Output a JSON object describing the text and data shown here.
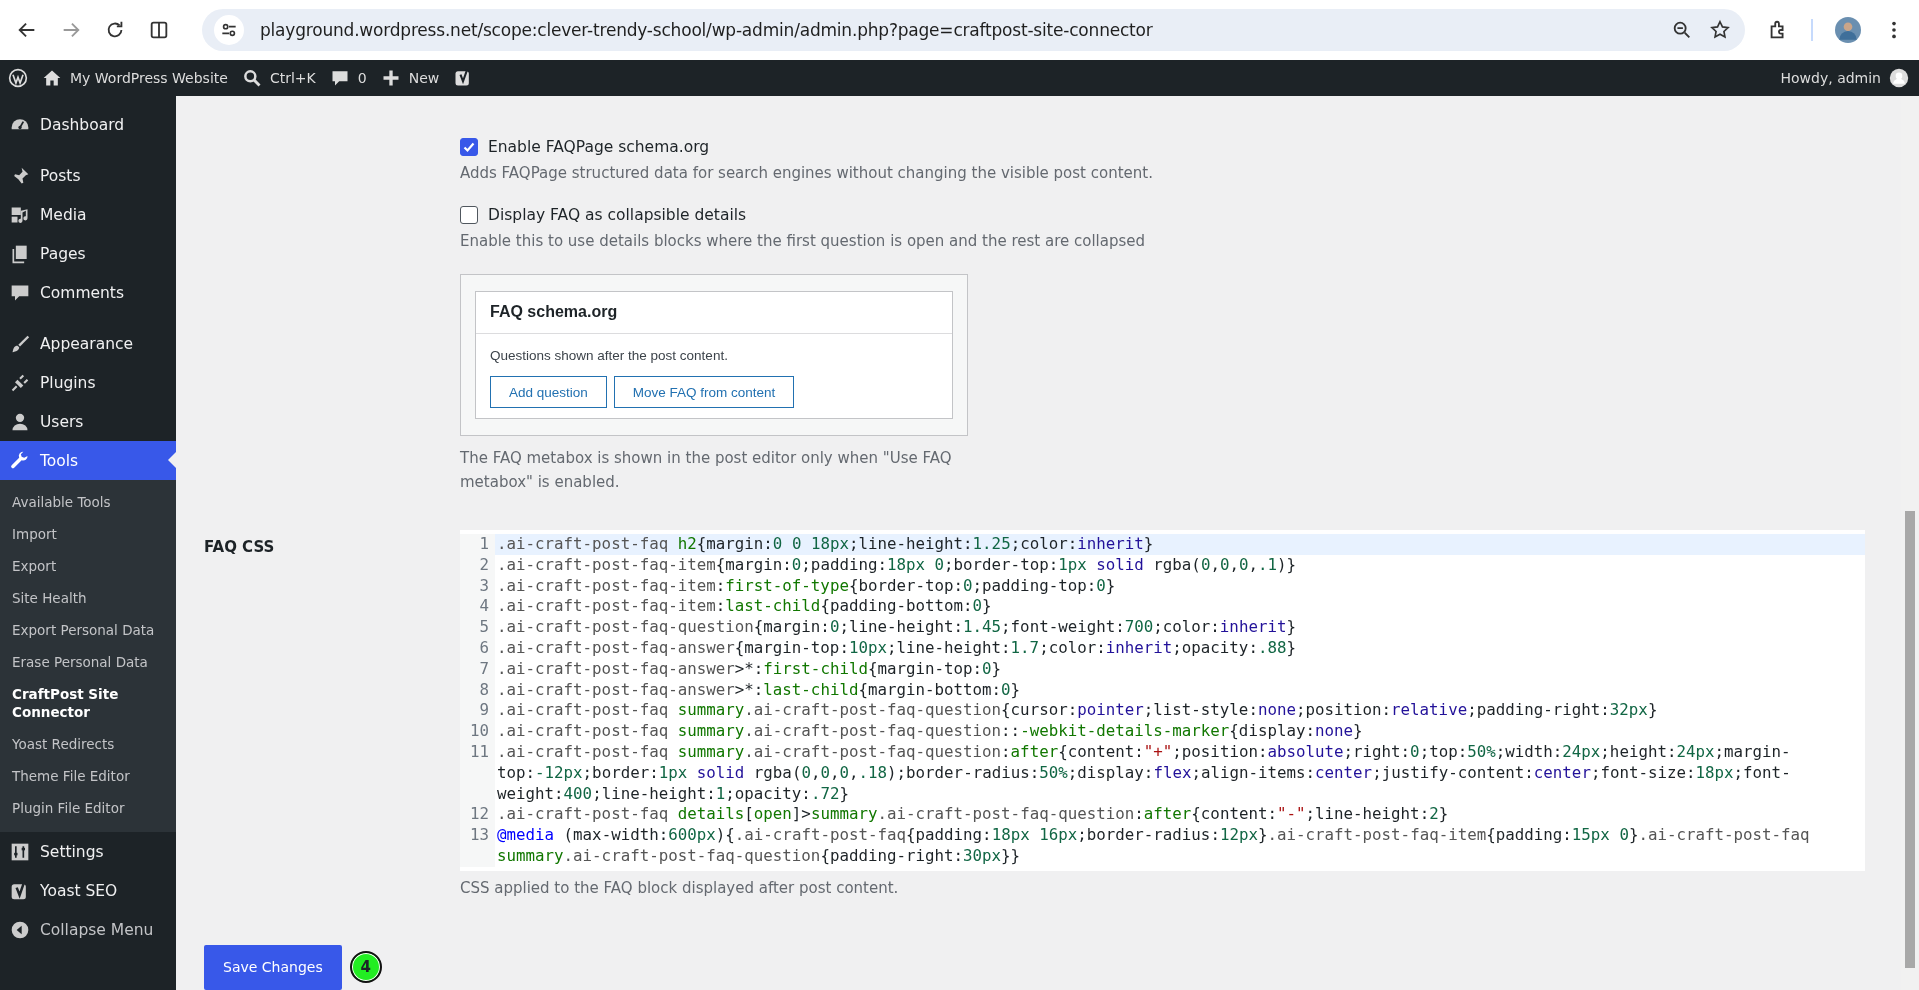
{
  "browser": {
    "url": "playground.wordpress.net/scope:clever-trendy-school/wp-admin/admin.php?page=craftpost-site-connector"
  },
  "admin_bar": {
    "site": "My WordPress Website",
    "search": "Ctrl+K",
    "comments": "0",
    "new": "New",
    "howdy": "Howdy, admin"
  },
  "sidebar": {
    "items": [
      {
        "kind": "menu",
        "label": "Dashboard",
        "selected": false
      },
      {
        "kind": "menu",
        "label": "Posts",
        "selected": false
      },
      {
        "kind": "menu",
        "label": "Media",
        "selected": false
      },
      {
        "kind": "menu",
        "label": "Pages",
        "selected": false
      },
      {
        "kind": "menu",
        "label": "Comments",
        "selected": false
      },
      {
        "kind": "menu",
        "label": "Appearance",
        "selected": false
      },
      {
        "kind": "menu",
        "label": "Plugins",
        "selected": false
      },
      {
        "kind": "menu",
        "label": "Users",
        "selected": false
      },
      {
        "kind": "menu",
        "label": "Tools",
        "selected": true,
        "children": [
          {
            "label": "Available Tools",
            "selected": false
          },
          {
            "label": "Import",
            "selected": false
          },
          {
            "label": "Export",
            "selected": false
          },
          {
            "label": "Site Health",
            "selected": false
          },
          {
            "label": "Export Personal Data",
            "selected": false
          },
          {
            "label": "Erase Personal Data",
            "selected": false
          },
          {
            "label": "CraftPost Site Connector",
            "selected": true
          },
          {
            "label": "Yoast Redirects",
            "selected": false
          },
          {
            "label": "Theme File Editor",
            "selected": false
          },
          {
            "label": "Plugin File Editor",
            "selected": false
          }
        ]
      },
      {
        "kind": "menu",
        "label": "Settings",
        "selected": false
      },
      {
        "kind": "menu",
        "label": "Yoast SEO",
        "selected": false
      },
      {
        "kind": "collapse",
        "label": "Collapse Menu",
        "selected": false
      }
    ]
  },
  "settings": {
    "options": [
      {
        "label": "Enable FAQPage schema.org",
        "checked": true,
        "description": "Adds FAQPage structured data for search engines without changing the visible post content."
      },
      {
        "label": "Display FAQ as collapsible details",
        "checked": false,
        "description": "Enable this to use details blocks where the first question is open and the rest are collapsed"
      }
    ],
    "preview": {
      "title": "FAQ schema.org",
      "text": "Questions shown after the post content.",
      "buttons": [
        "Add question",
        "Move FAQ from content"
      ]
    },
    "preview_note": "The FAQ metabox is shown in the post editor only when \"Use FAQ metabox\" is enabled.",
    "faq_css": {
      "label": "FAQ CSS",
      "lines": [
        {
          "number": "1",
          "code": ".ai-craft-post-faq h2{margin:0 0 18px;line-height:1.25;color:inherit}"
        },
        {
          "number": "2",
          "code": ".ai-craft-post-faq-item{margin:0;padding:18px 0;border-top:1px solid rgba(0,0,0,.1)}"
        },
        {
          "number": "3",
          "code": ".ai-craft-post-faq-item:first-of-type{border-top:0;padding-top:0}"
        },
        {
          "number": "4",
          "code": ".ai-craft-post-faq-item:last-child{padding-bottom:0}"
        },
        {
          "number": "5",
          "code": ".ai-craft-post-faq-question{margin:0;line-height:1.45;font-weight:700;color:inherit}"
        },
        {
          "number": "6",
          "code": ".ai-craft-post-faq-answer{margin-top:10px;line-height:1.7;color:inherit;opacity:.88}"
        },
        {
          "number": "7",
          "code": ".ai-craft-post-faq-answer>*:first-child{margin-top:0}"
        },
        {
          "number": "8",
          "code": ".ai-craft-post-faq-answer>*:last-child{margin-bottom:0}"
        },
        {
          "number": "9",
          "code": ".ai-craft-post-faq summary.ai-craft-post-faq-question{cursor:pointer;list-style:none;position:relative;padding-right:32px}"
        },
        {
          "number": "10",
          "code": ".ai-craft-post-faq summary.ai-craft-post-faq-question::-webkit-details-marker{display:none}"
        },
        {
          "number": "11",
          "code": ".ai-craft-post-faq summary.ai-craft-post-faq-question:after{content:\"+\";position:absolute;right:0;top:50%;width:24px;height:24px;margin-top:-12px;border:1px solid rgba(0,0,0,.18);border-radius:50%;display:flex;align-items:center;justify-content:center;font-size:18px;font-weight:400;line-height:1;opacity:.72}"
        },
        {
          "number": "12",
          "code": ".ai-craft-post-faq details[open]>summary.ai-craft-post-faq-question:after{content:\"-\";line-height:2}"
        },
        {
          "number": "13",
          "code": "@media (max-width:600px){.ai-craft-post-faq{padding:18px 16px;border-radius:12px}.ai-craft-post-faq-item{padding:15px 0}.ai-craft-post-faq summary.ai-craft-post-faq-question{padding-right:30px}}"
        }
      ],
      "help": "CSS applied to the FAQ block displayed after post content."
    },
    "save_button": "Save Changes",
    "step_badge": "4"
  }
}
